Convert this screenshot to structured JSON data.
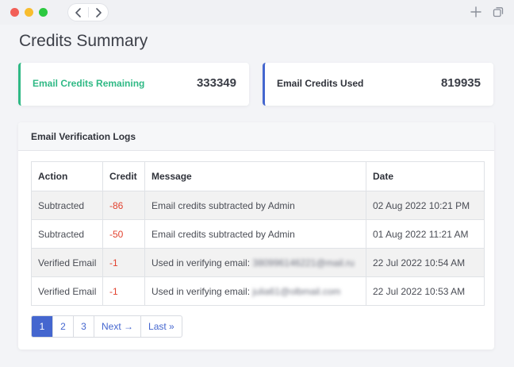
{
  "window": {
    "nav": {
      "back_icon": "chevron-left-icon",
      "forward_icon": "chevron-right-icon"
    },
    "actions": {
      "new_tab_icon": "plus-icon",
      "tabs_icon": "tab-overview-icon"
    }
  },
  "page": {
    "title": "Credits Summary"
  },
  "stats": {
    "remaining": {
      "label": "Email Credits Remaining",
      "value": "333349",
      "accent": "#2fb985"
    },
    "used": {
      "label": "Email Credits Used",
      "value": "819935",
      "accent": "#4466cf"
    }
  },
  "logs": {
    "title": "Email Verification Logs",
    "columns": [
      "Action",
      "Credit",
      "Message",
      "Date"
    ],
    "rows": [
      {
        "action": "Subtracted",
        "credit": "-86",
        "message": "Email credits subtracted by Admin",
        "email": "",
        "date": "02 Aug 2022 10:21 PM"
      },
      {
        "action": "Subtracted",
        "credit": "-50",
        "message": "Email credits subtracted by Admin",
        "email": "",
        "date": "01 Aug 2022 11:21 AM"
      },
      {
        "action": "Verified Email",
        "credit": "-1",
        "message": "Used in verifying email: ",
        "email": "380996146221@mail.ru",
        "date": "22 Jul 2022 10:54 AM"
      },
      {
        "action": "Verified Email",
        "credit": "-1",
        "message": "Used in verifying email: ",
        "email": "julia61@olbmail.com",
        "date": "22 Jul 2022 10:53 AM"
      }
    ]
  },
  "pagination": {
    "pages": [
      "1",
      "2",
      "3"
    ],
    "active": "1",
    "next": "Next →",
    "last": "Last »"
  },
  "colors": {
    "accent": "#4466cf",
    "success": "#2fb985",
    "danger": "#e2422f"
  }
}
